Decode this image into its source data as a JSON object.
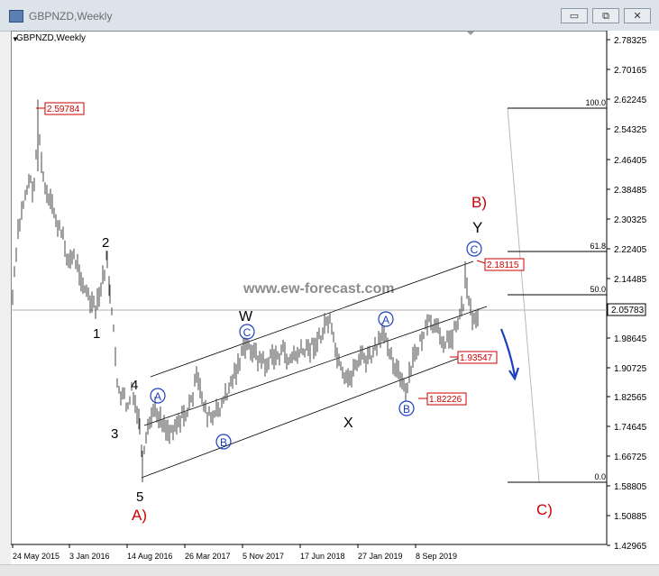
{
  "window": {
    "title": "GBPNZD,Weekly",
    "buttons": {
      "minimize": "▭",
      "restore": "⧉",
      "close": "✕"
    }
  },
  "chart_label": "GBPNZD,Weekly",
  "watermark": "www.ew-forecast.com",
  "price_axis_labels": [
    "2.78325",
    "2.70165",
    "2.62245",
    "2.54325",
    "2.46405",
    "2.38485",
    "2.30325",
    "2.22405",
    "2.14485",
    "1.98645",
    "1.90725",
    "1.82565",
    "1.74645",
    "1.66725",
    "1.58805",
    "1.50885",
    "1.42965"
  ],
  "current_price": "2.05783",
  "time_axis_labels": [
    "24 May 2015",
    "3 Jan 2016",
    "14 Aug 2016",
    "26 Mar 2017",
    "5 Nov 2017",
    "17 Jun 2018",
    "27 Jan 2019",
    "8 Sep 2019"
  ],
  "price_callouts": [
    "2.59784",
    "2.18115",
    "1.93547",
    "1.82226"
  ],
  "fib_levels": [
    "100.0",
    "61.8",
    "50.0",
    "0.0"
  ],
  "wave_labels": {
    "w1": "1",
    "w2": "2",
    "w3": "3",
    "w4": "4",
    "w5": "5",
    "A_big": "A)",
    "B_big": "B)",
    "C_big": "C)",
    "W": "W",
    "X": "X",
    "Y": "Y",
    "circle_A": "A",
    "circle_B": "B",
    "circle_C": "C"
  },
  "colors": {
    "red": "#cc0000",
    "blue": "#1a3fbf",
    "price_line": "#444444",
    "fib": "#000000"
  },
  "chart_data": {
    "type": "line",
    "title": "GBPNZD,Weekly",
    "ylim": [
      1.42965,
      2.78325
    ],
    "x": [
      "24 May 2015",
      "3 Jan 2016",
      "14 Aug 2016",
      "26 Mar 2017",
      "5 Nov 2017",
      "17 Jun 2018",
      "27 Jan 2019",
      "8 Sep 2019"
    ],
    "series": [
      {
        "values": [
          2.35,
          2.05,
          1.6,
          1.75,
          1.98,
          2.03,
          1.95,
          2.06
        ]
      }
    ],
    "annotations": {
      "high": 2.59784,
      "recent_high": 2.18115,
      "support": 1.93547,
      "low_B": 1.82226,
      "last": 2.05783
    },
    "grid": false
  }
}
